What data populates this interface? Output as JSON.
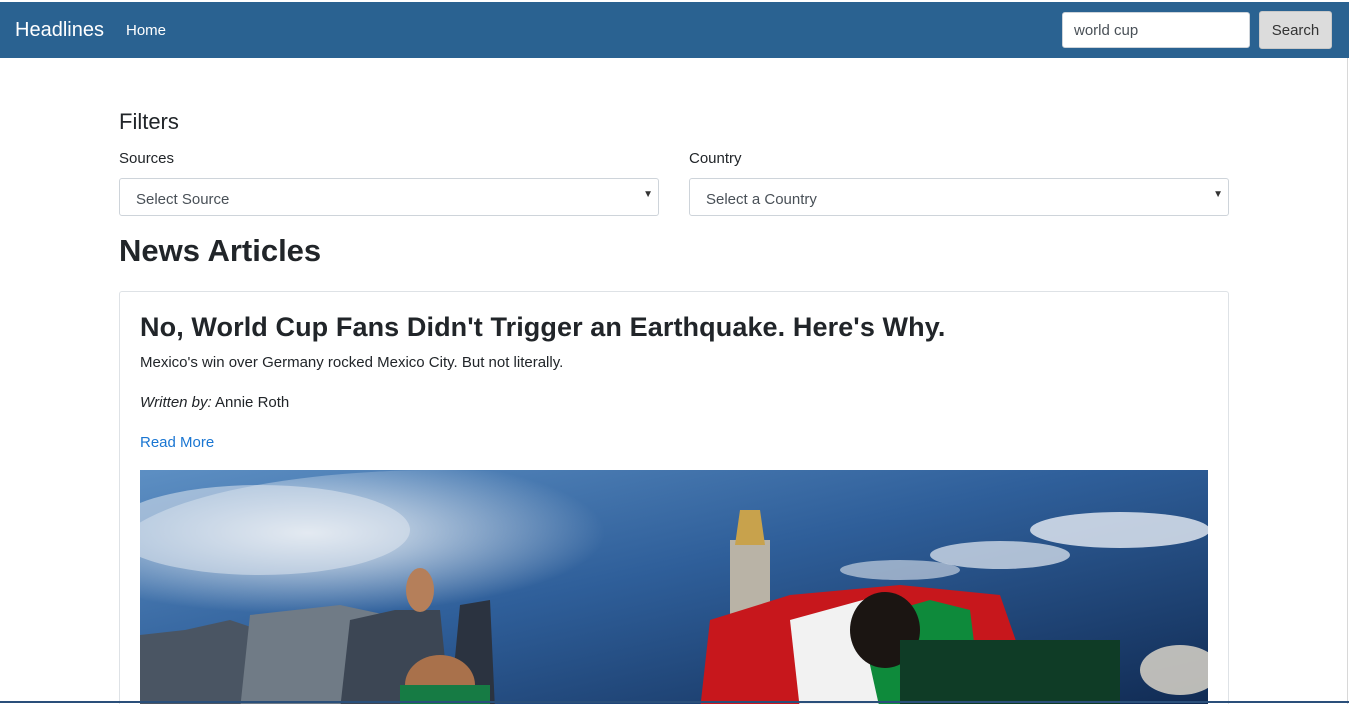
{
  "navbar": {
    "brand": "Headlines",
    "home_label": "Home",
    "search_value": "world cup",
    "search_button": "Search"
  },
  "filters": {
    "title": "Filters",
    "sources_label": "Sources",
    "sources_selected": "Select Source",
    "country_label": "Country",
    "country_selected": "Select a Country"
  },
  "news": {
    "title": "News Articles",
    "articles": [
      {
        "title": "No, World Cup Fans Didn't Trigger an Earthquake. Here's Why.",
        "description": "Mexico's win over Germany rocked Mexico City. But not literally.",
        "author_prefix": "Written by:",
        "author": "Annie Roth",
        "read_more": "Read More"
      }
    ]
  },
  "colors": {
    "navbar": "#2a6291",
    "link": "#1a76d2"
  }
}
